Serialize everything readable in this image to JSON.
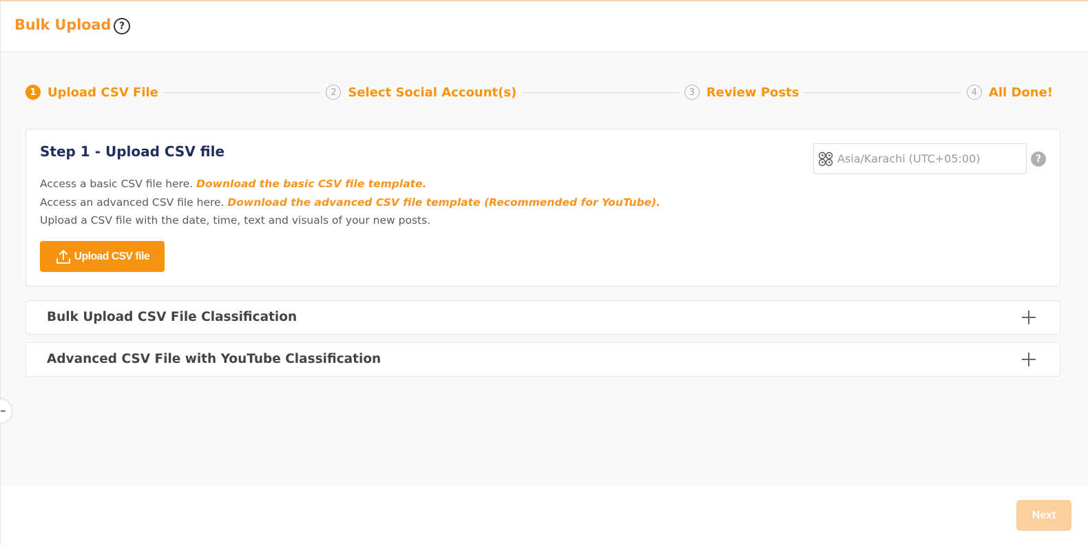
{
  "header": {
    "title": "Bulk Upload",
    "help_icon": "question-circle-icon",
    "help_glyph": "?"
  },
  "stepper": {
    "steps": [
      {
        "number": "1",
        "label": "Upload CSV File",
        "active": true
      },
      {
        "number": "2",
        "label": "Select Social Account(s)",
        "active": false
      },
      {
        "number": "3",
        "label": "Review Posts",
        "active": false
      },
      {
        "number": "4",
        "label": "All Done!",
        "active": false
      }
    ]
  },
  "step_card": {
    "title": "Step 1 - Upload CSV file",
    "line1_text": "Access a basic CSV file here.",
    "line1_link": "Download the basic CSV file template.",
    "line2_text": "Access an advanced CSV file here.",
    "line2_link": "Download the advanced CSV file template (Recommended for YouTube).",
    "line3_text": "Upload a CSV file with the date, time, text and visuals of your new posts.",
    "upload_button": "Upload CSV file",
    "upload_icon": "upload-icon",
    "timezone": {
      "value": "Asia/Karachi (UTC+05:00)",
      "icon": "world-clock-icon"
    },
    "timezone_help_glyph": "?"
  },
  "accordions": [
    {
      "title": "Bulk Upload CSV File Classification",
      "icon": "plus-icon"
    },
    {
      "title": "Advanced CSV File with YouTube Classification",
      "icon": "plus-icon"
    }
  ],
  "footer": {
    "next_button": "Next",
    "next_disabled": true
  },
  "colors": {
    "accent": "#f7940f",
    "title_navy": "#1f2d5a",
    "next_disabled": "#fdcf9c"
  }
}
